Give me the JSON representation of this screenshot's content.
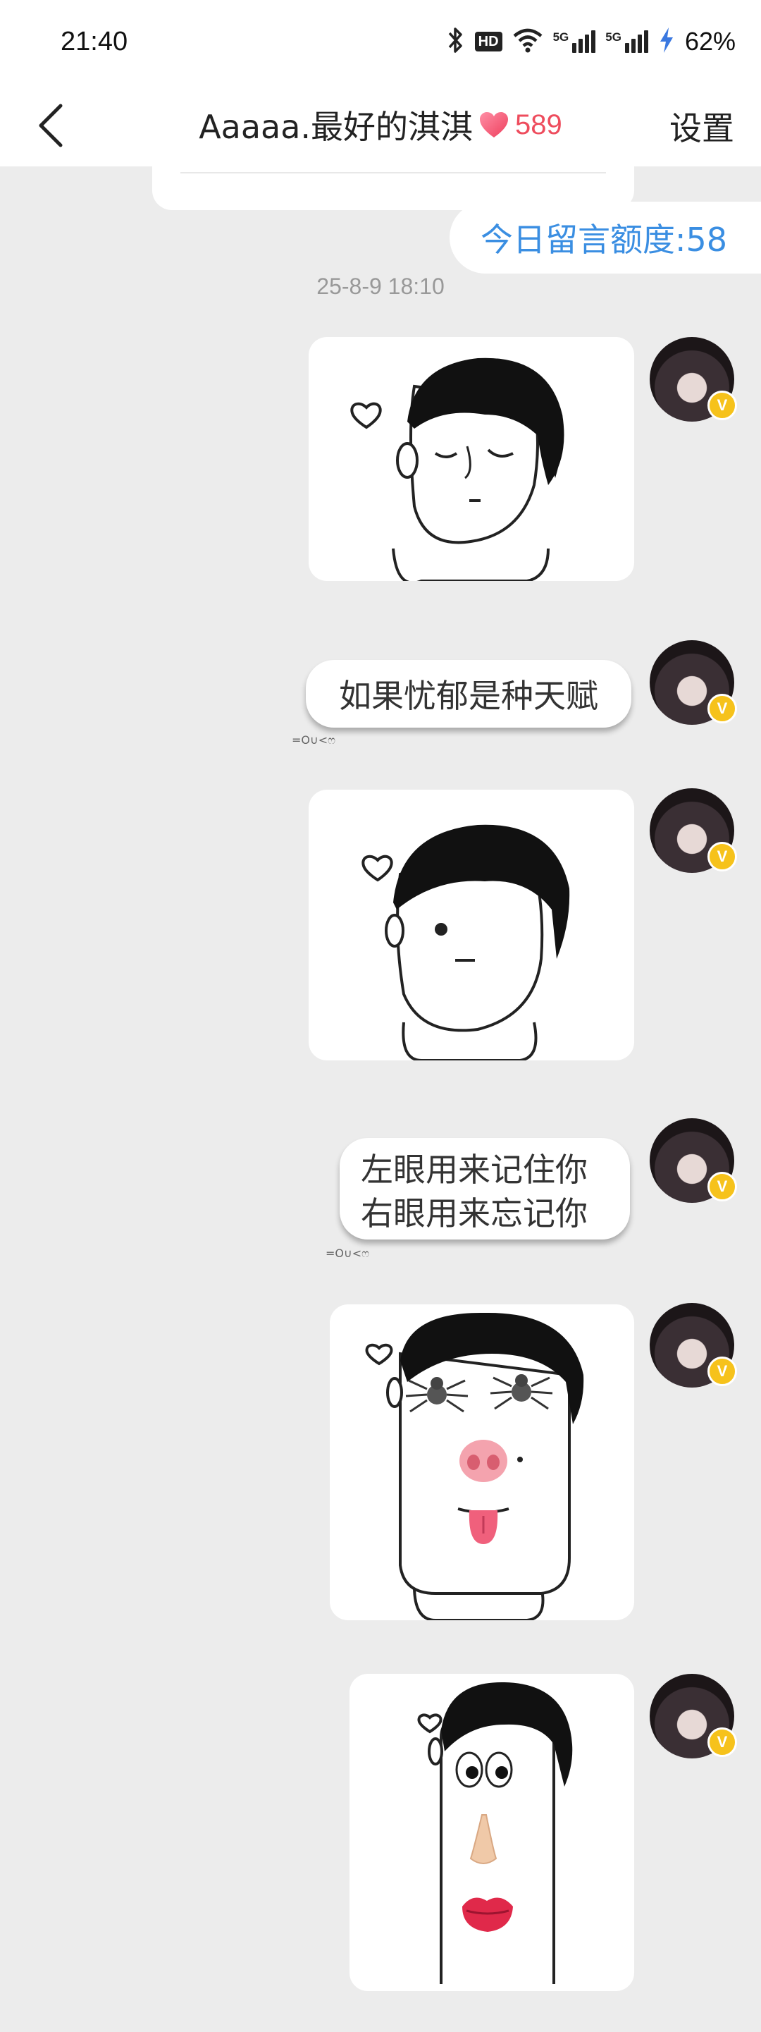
{
  "status_bar": {
    "time": "21:40",
    "hd_badge": "HD",
    "network_1": "5G",
    "network_2": "5G",
    "battery": "62%"
  },
  "header": {
    "title": "Aaaaa.最好的淇淇",
    "heart_count": "589",
    "settings_label": "设置"
  },
  "chat": {
    "quota_label": "今日留言额度:58",
    "timestamp": "25-8-9 18:10",
    "messages": [
      {
        "type": "sticker"
      },
      {
        "type": "text",
        "text": "如果忧郁是种天赋",
        "decoration": "=O∪<ෆ"
      },
      {
        "type": "sticker"
      },
      {
        "type": "text",
        "line1": "左眼用来记住你",
        "line2": "右眼用来忘记你",
        "decoration": "=O∪<ෆ"
      },
      {
        "type": "sticker"
      },
      {
        "type": "sticker"
      }
    ]
  },
  "colors": {
    "accent_blue": "#3a8ee2",
    "heart_red": "#ee4c5d",
    "chat_bg": "#ececec",
    "badge_yellow": "#f6c21b"
  }
}
